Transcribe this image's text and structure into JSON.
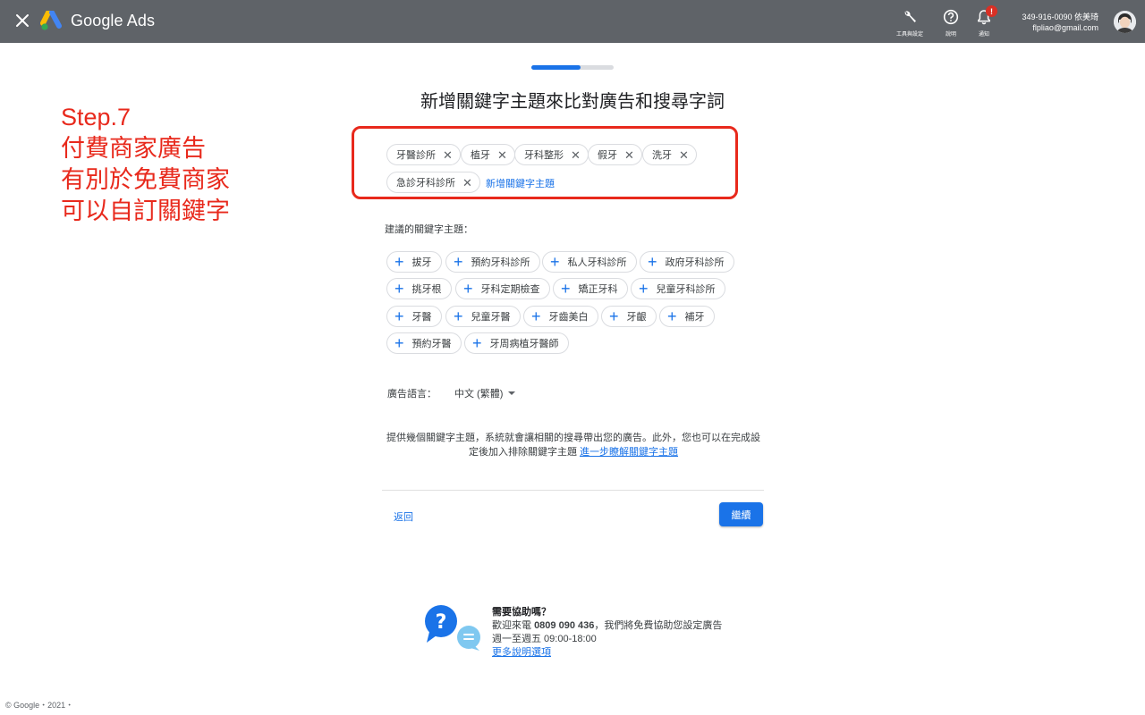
{
  "header": {
    "brand": "Google Ads",
    "tools_label": "工具與設定",
    "help_label": "說明",
    "notifications_label": "通知",
    "notification_badge": "!",
    "account_id": "349-916-0090 依美琦",
    "account_email": "flpliao@gmail.com"
  },
  "progress": {
    "value": 0.6
  },
  "title": "新增關鍵字主題來比對廣告和搜尋字詞",
  "annotation": {
    "lines": [
      "Step.7",
      "付費商家廣告",
      "有別於免費商家",
      "可以自訂關鍵字"
    ],
    "color": "#e8291c"
  },
  "selected_keywords": [
    "牙醫診所",
    "植牙",
    "牙科整形",
    "假牙",
    "洗牙",
    "急診牙科診所"
  ],
  "remove_glyph": "✕",
  "add_keyword_label": "新增關鍵字主題",
  "suggestions": {
    "title": "建議的關鍵字主題：",
    "plus_glyph": "+",
    "items": [
      "拔牙",
      "預約牙科診所",
      "私人牙科診所",
      "政府牙科診所",
      "挑牙根",
      "牙科定期檢查",
      "矯正牙科",
      "兒童牙科診所",
      "牙醫",
      "兒童牙醫",
      "牙齒美白",
      "牙齦",
      "補牙",
      "預約牙醫",
      "牙周病植牙醫師"
    ]
  },
  "language": {
    "label": "廣告語言：",
    "value": "中文 (繁體)"
  },
  "info": {
    "text": "提供幾個關鍵字主題，系統就會讓相關的搜尋帶出您的廣告。此外，您也可以在完成設定後加入排除關鍵字主題",
    "link": "進一步瞭解關鍵字主題"
  },
  "buttons": {
    "back": "返回",
    "continue": "繼續"
  },
  "help": {
    "heading": "需要協助嗎？",
    "line1_prefix": "歡迎來電",
    "phone": "0809 090 436",
    "line1_suffix": "，我們將免費協助您設定廣告",
    "hours": "週一至週五 09:00-18:00",
    "more_link": "更多說明選項"
  },
  "footer": "© Google・2021・",
  "colors": {
    "accent": "#1a73e8",
    "topbar": "#5f6368",
    "annotation": "#e8291c"
  }
}
